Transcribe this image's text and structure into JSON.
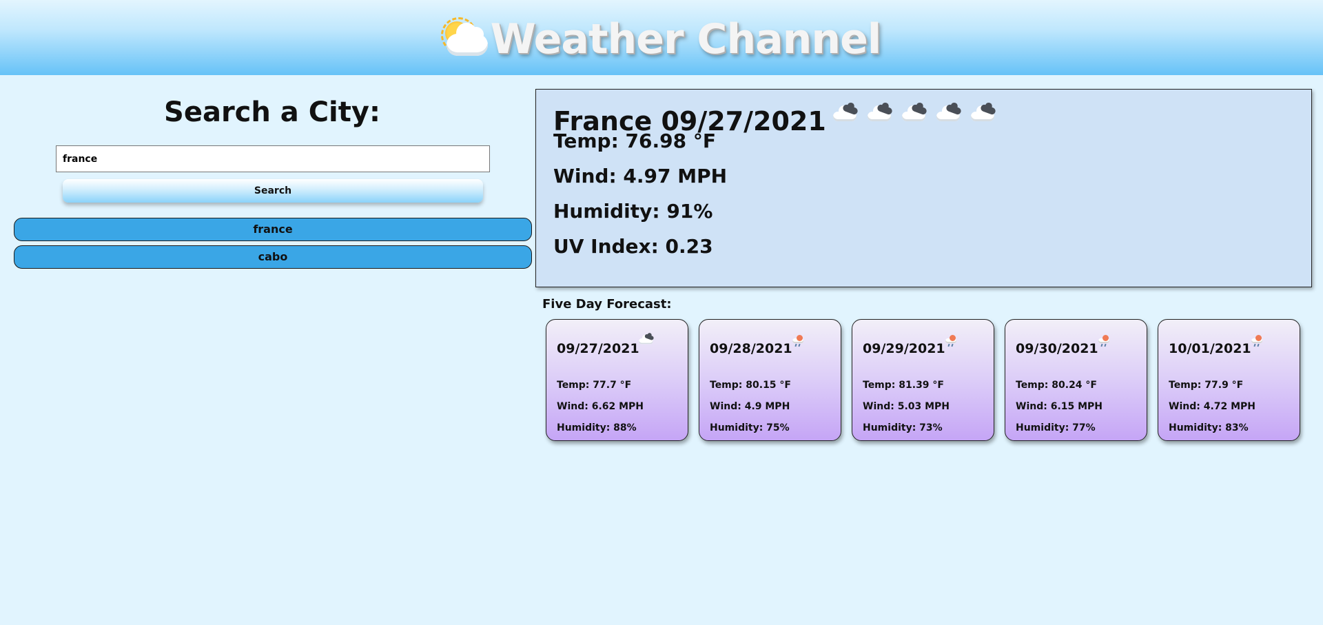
{
  "header": {
    "title": "Weather Channel",
    "logo_icon": "sun-behind-cloud-icon"
  },
  "search": {
    "title": "Search a City:",
    "input_value": "france",
    "button_label": "Search"
  },
  "history": [
    {
      "label": "france"
    },
    {
      "label": "cabo"
    }
  ],
  "current": {
    "heading": "France 09/27/2021",
    "icons": [
      "cloud-icon",
      "cloud-icon",
      "cloud-icon",
      "cloud-icon",
      "cloud-icon"
    ],
    "temp": "Temp: 76.98 °F",
    "wind": "Wind: 4.97 MPH",
    "humidity": "Humidity: 91%",
    "uv": "UV Index: 0.23"
  },
  "forecast": {
    "title": "Five Day Forecast:",
    "days": [
      {
        "date": "09/27/2021",
        "icon": "cloud-icon",
        "temp": "Temp: 77.7 °F",
        "wind": "Wind: 6.62 MPH",
        "humidity": "Humidity: 88%"
      },
      {
        "date": "09/28/2021",
        "icon": "rain-icon",
        "temp": "Temp: 80.15 °F",
        "wind": "Wind: 4.9 MPH",
        "humidity": "Humidity: 75%"
      },
      {
        "date": "09/29/2021",
        "icon": "rain-icon",
        "temp": "Temp: 81.39 °F",
        "wind": "Wind: 5.03 MPH",
        "humidity": "Humidity: 73%"
      },
      {
        "date": "09/30/2021",
        "icon": "rain-icon",
        "temp": "Temp: 80.24 °F",
        "wind": "Wind: 6.15 MPH",
        "humidity": "Humidity: 77%"
      },
      {
        "date": "10/01/2021",
        "icon": "rain-icon",
        "temp": "Temp: 77.9 °F",
        "wind": "Wind: 4.72 MPH",
        "humidity": "Humidity: 83%"
      }
    ]
  },
  "colors": {
    "page_bg": "#e1f4fe",
    "history_button": "#3aa6e6",
    "current_box": "#cfe2f6",
    "card_bottom": "#c5a5f6"
  }
}
